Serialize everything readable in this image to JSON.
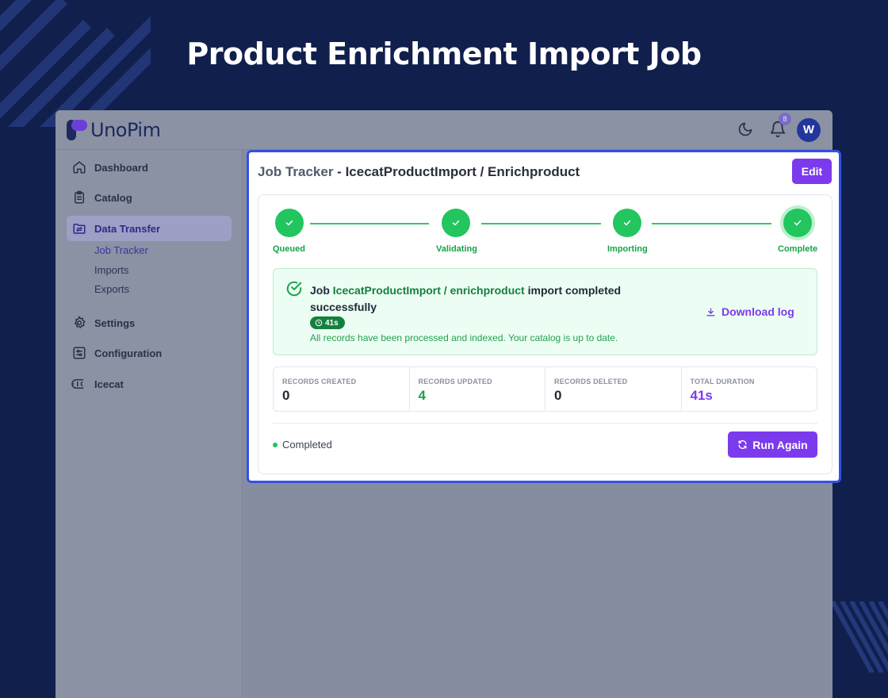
{
  "hero": {
    "title": "Product Enrichment Import Job"
  },
  "app": {
    "logo_text": "UnoPim",
    "notifications_count": "8",
    "avatar_initial": "W"
  },
  "sidebar": {
    "items": [
      {
        "label": "Dashboard",
        "icon": "home-icon"
      },
      {
        "label": "Catalog",
        "icon": "clipboard-icon"
      },
      {
        "label": "Data Transfer",
        "icon": "folder-transfer-icon",
        "active": true
      },
      {
        "label": "Settings",
        "icon": "gear-icon"
      },
      {
        "label": "Configuration",
        "icon": "sliders-icon"
      },
      {
        "label": "Icecat",
        "icon": "icecat-icon"
      }
    ],
    "sub_items": [
      "Job Tracker",
      "Imports",
      "Exports"
    ]
  },
  "card": {
    "title_prefix": "Job Tracker",
    "title_sep": " - ",
    "title_main": "IcecatProductImport / Enrichproduct",
    "edit_label": "Edit",
    "steps": [
      "Queued",
      "Validating",
      "Importing",
      "Complete"
    ],
    "success": {
      "prefix": "Job ",
      "job": "IcecatProductImport / enrichproduct",
      "suffix": " import completed successfully",
      "duration": "41s",
      "description": "All records have been processed and indexed. Your catalog is up to date.",
      "download_label": "Download log"
    },
    "stats": [
      {
        "label": "RECORDS CREATED",
        "value": "0",
        "color": "#1f2937"
      },
      {
        "label": "RECORDS UPDATED",
        "value": "4",
        "color": "#16a34a"
      },
      {
        "label": "RECORDS DELETED",
        "value": "0",
        "color": "#1f2937"
      },
      {
        "label": "TOTAL DURATION",
        "value": "41s",
        "color": "#7c3aed"
      }
    ],
    "status": "Completed",
    "run_again_label": "Run Again"
  },
  "colors": {
    "accent": "#7c3aed",
    "success": "#22c55e",
    "background": "#111f4d",
    "focus_border": "#3350e6"
  }
}
